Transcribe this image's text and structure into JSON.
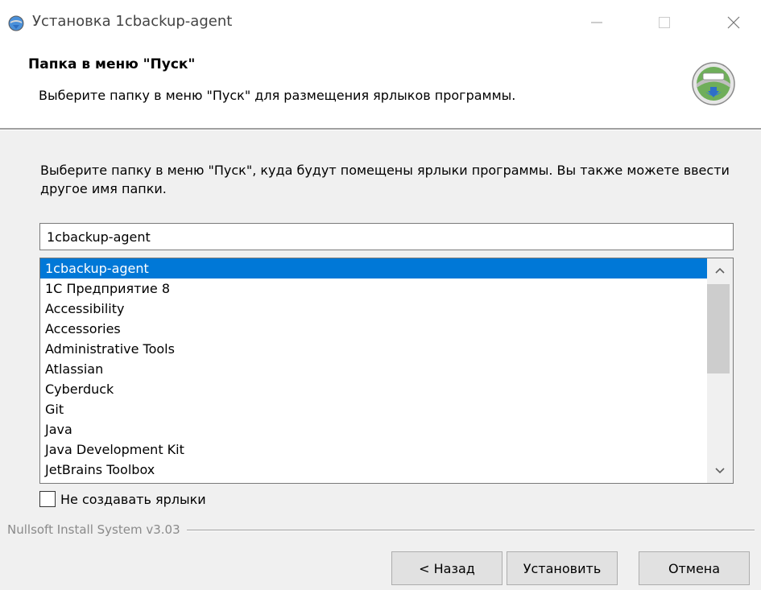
{
  "window": {
    "title": "Установка 1cbackup-agent",
    "controls": {
      "minimize_glyph": "—",
      "maximize_glyph": "☐",
      "close_glyph": "✕"
    }
  },
  "header": {
    "title": "Папка в меню \"Пуск\"",
    "subtitle": "Выберите папку в меню \"Пуск\" для размещения ярлыков программы."
  },
  "body": {
    "instructions": "Выберите папку в меню \"Пуск\", куда будут помещены ярлыки программы. Вы также можете ввести другое имя папки.",
    "folder_input_value": "1cbackup-agent",
    "folder_list": {
      "selected_index": 0,
      "items": [
        "1cbackup-agent",
        "1С Предприятие 8",
        "Accessibility",
        "Accessories",
        "Administrative Tools",
        "Atlassian",
        "Cyberduck",
        "Git",
        "Java",
        "Java Development Kit",
        "JetBrains Toolbox"
      ]
    },
    "no_shortcuts_label": "Не создавать ярлыки",
    "no_shortcuts_checked": false
  },
  "footer": {
    "branding": "Nullsoft Install System v3.03",
    "back_label": "< Назад",
    "install_label": "Установить",
    "cancel_label": "Отмена"
  },
  "colors": {
    "selection": "#0078d7",
    "window_bg": "#f0f0f0"
  },
  "icons": {
    "app": "installer-globe-icon",
    "header_logo": "nsis-install-icon"
  }
}
